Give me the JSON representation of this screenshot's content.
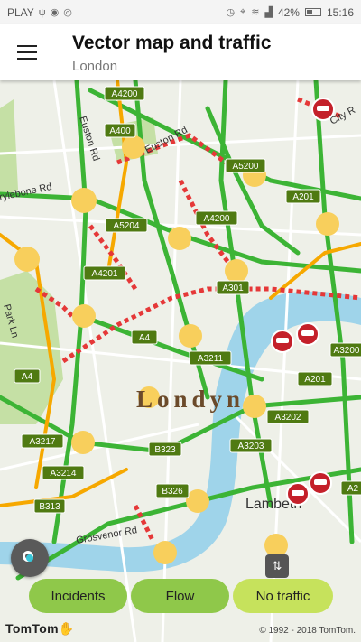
{
  "status_bar": {
    "carrier": "PLAY",
    "battery_percent": "42%",
    "battery_level": 0.42,
    "time": "15:16"
  },
  "app_bar": {
    "title": "Vector map and traffic",
    "subtitle": "London"
  },
  "map": {
    "city_label": "Londyn",
    "district_label": "Lambeth",
    "road_shields": [
      "A4200",
      "A400",
      "A5200",
      "A201",
      "A5204",
      "A4200",
      "A4201",
      "A301",
      "A4",
      "A3211",
      "A201",
      "A3200",
      "A4",
      "A3217",
      "A3202",
      "B323",
      "A3203",
      "A3214",
      "B326",
      "B313",
      "A2"
    ],
    "street_labels": [
      "Euston Rd",
      "City R",
      "rylebone Rd",
      "Park Ln",
      "Grosvenor Rd"
    ],
    "colors": {
      "land": "#eef0e8",
      "water": "#9fd4ea",
      "park": "#c5e0a5",
      "flow_free": "#3cb435",
      "flow_slow": "#f6a800",
      "flow_jam": "#e53838",
      "closure": "#c4202a",
      "shield": "#4f7a12",
      "node": "#f8cf5c"
    }
  },
  "buttons": {
    "incidents": "Incidents",
    "flow": "Flow",
    "no_traffic": "No traffic"
  },
  "footer": {
    "logo": "TomTom",
    "copyright": "© 1992 - 2018 TomTom."
  }
}
